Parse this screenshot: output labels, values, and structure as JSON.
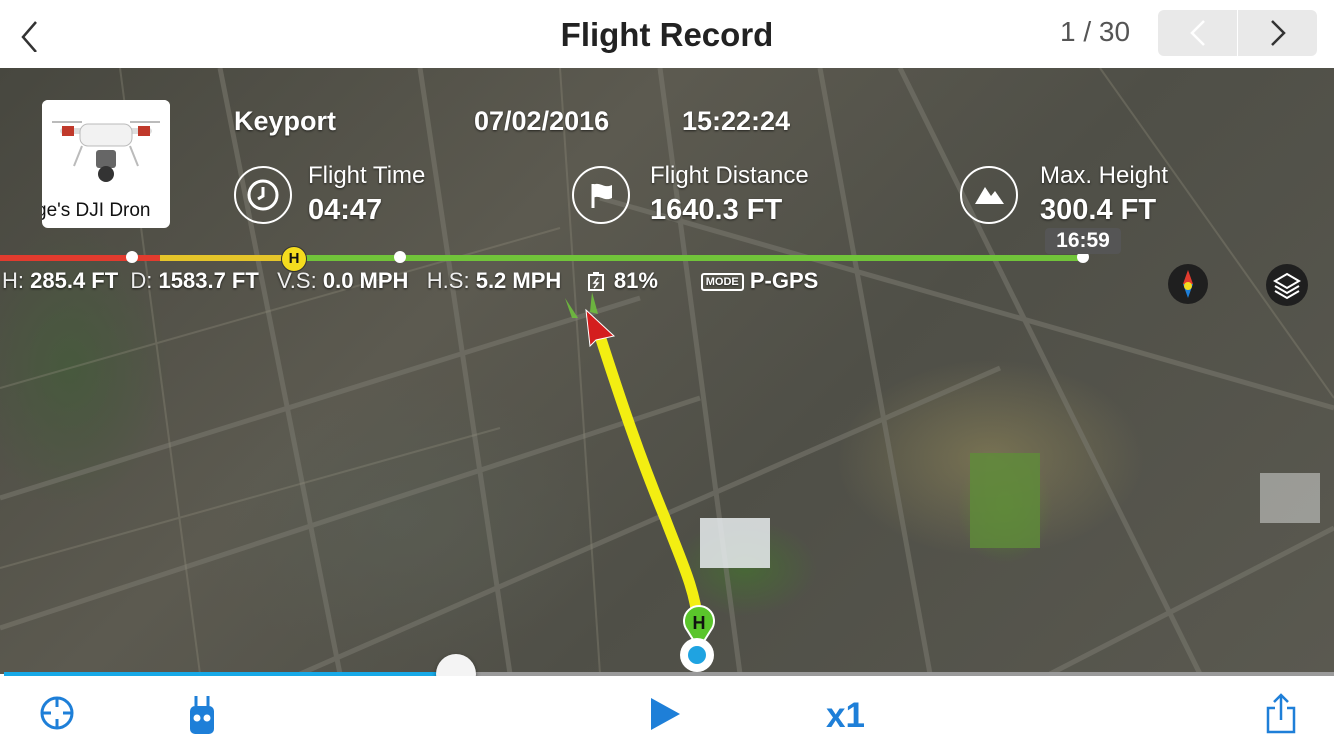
{
  "header": {
    "title": "Flight Record",
    "page_counter": "1 / 30"
  },
  "flight": {
    "aircraft_name": "ge's DJI Dron",
    "location": "Keyport",
    "date": "07/02/2016",
    "time": "15:22:24",
    "flight_time_label": "Flight Time",
    "flight_time_value": "04:47",
    "flight_distance_label": "Flight Distance",
    "flight_distance_value": "1640.3 FT",
    "max_height_label": "Max. Height",
    "max_height_value": "300.4 FT",
    "timeline_end_time": "16:59",
    "home_marker": "H"
  },
  "telemetry": {
    "h_label": "H:",
    "h_value": "285.4 FT",
    "d_label": "D:",
    "d_value": "1583.7 FT",
    "vs_label": "V.S:",
    "vs_value": "0.0 MPH",
    "hs_label": "H.S:",
    "hs_value": "5.2 MPH",
    "battery_value": "81%",
    "mode_badge": "MODE",
    "mode_value": "P-GPS"
  },
  "playback": {
    "progress": 0.34,
    "speed_label": "x1"
  },
  "icons": {
    "back": "chevron-left-icon",
    "prev": "chevron-left-icon",
    "next": "chevron-right-icon",
    "flight_time": "clock-icon",
    "flight_distance": "flag-icon",
    "max_height": "mountain-icon",
    "battery": "battery-icon",
    "compass": "compass-icon",
    "layers": "layers-icon",
    "locate": "crosshair-icon",
    "remote": "remote-controller-icon",
    "play": "play-icon",
    "share": "share-icon"
  },
  "colors": {
    "accent_blue": "#17a9e7",
    "speed_blue": "#1e7fd8",
    "path_yellow": "#f3ee12",
    "timeline_red": "#e23b2e",
    "timeline_yellow": "#e5c52a",
    "timeline_green": "#71c43a",
    "home_green": "#5ac52b",
    "aircraft_red": "#d41e1e"
  }
}
